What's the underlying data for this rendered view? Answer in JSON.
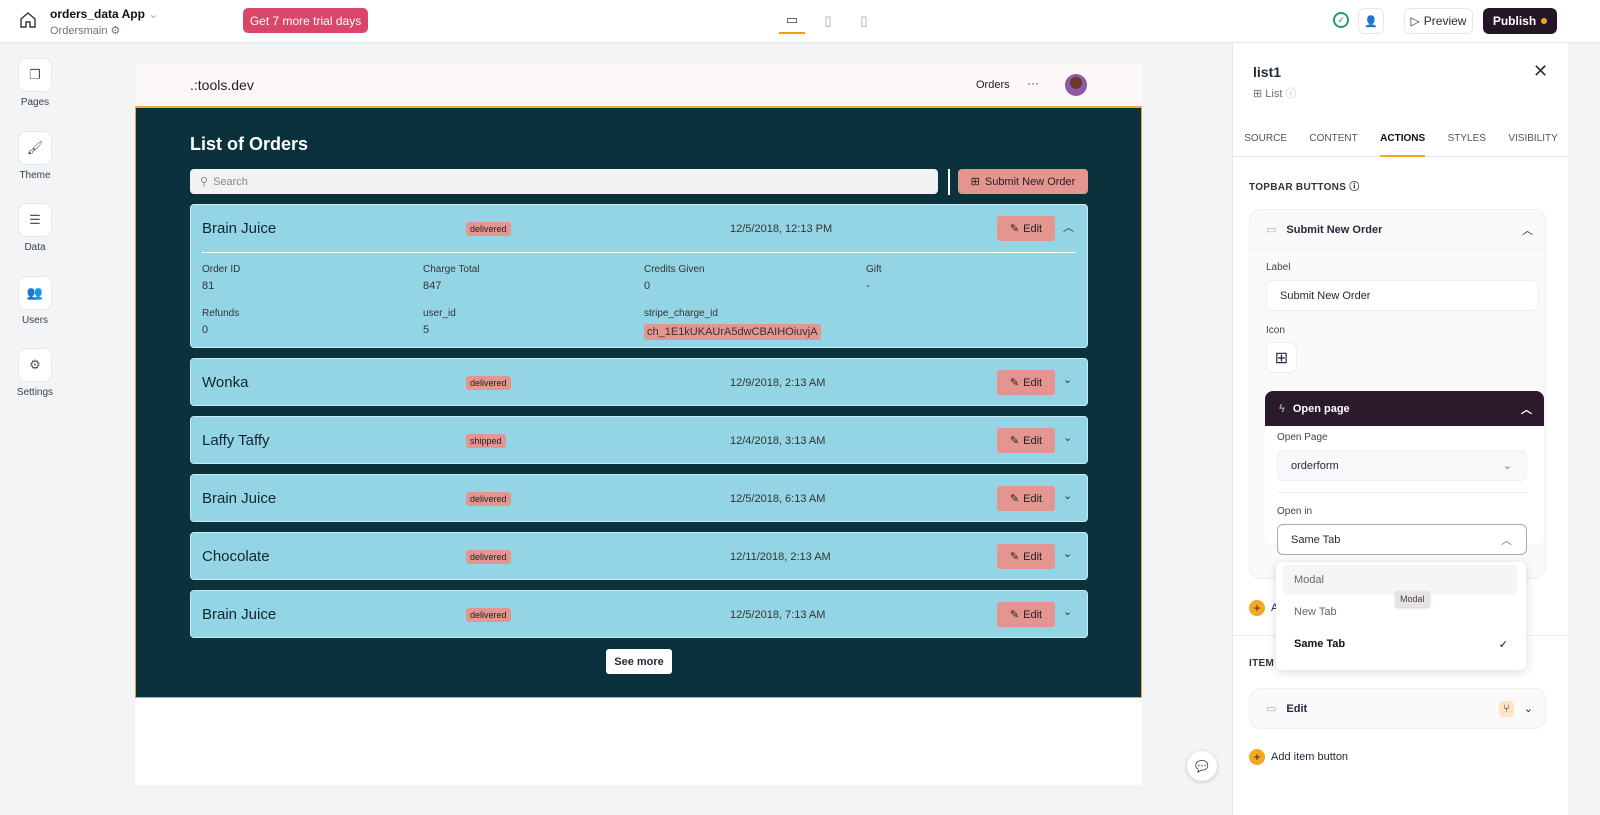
{
  "topbar": {
    "app_name": "orders_data App",
    "page_name": "Ordersmain",
    "trial_label": "Get 7 more trial days",
    "preview_label": "Preview",
    "publish_label": "Publish",
    "status_color": "#22a06b",
    "accent": "#d9466a"
  },
  "sidebar": {
    "items": [
      {
        "label": "Pages",
        "icon": "pages-icon"
      },
      {
        "label": "Theme",
        "icon": "theme-icon"
      },
      {
        "label": "Data",
        "icon": "database-icon"
      },
      {
        "label": "Users",
        "icon": "users-icon"
      },
      {
        "label": "Settings",
        "icon": "gear-icon"
      }
    ]
  },
  "app": {
    "logo": ".:tools.dev",
    "nav_orders": "Orders",
    "nav_more": "···",
    "title": "List of Orders",
    "search_placeholder": "Search",
    "submit_label": "Submit New Order",
    "see_more": "See more",
    "edit_label": "Edit",
    "orders": [
      {
        "name": "Brain Juice",
        "status": "delivered",
        "date": "12/5/2018, 12:13 PM",
        "expanded": true
      },
      {
        "name": "Wonka",
        "status": "delivered",
        "date": "12/9/2018, 2:13 AM"
      },
      {
        "name": "Laffy Taffy",
        "status": "shipped",
        "date": "12/4/2018, 3:13 AM"
      },
      {
        "name": "Brain Juice",
        "status": "delivered",
        "date": "12/5/2018, 6:13 AM"
      },
      {
        "name": "Chocolate",
        "status": "delivered",
        "date": "12/11/2018, 2:13 AM"
      },
      {
        "name": "Brain Juice",
        "status": "delivered",
        "date": "12/5/2018, 7:13 AM"
      }
    ],
    "details": [
      {
        "label": "Order ID",
        "value": "81"
      },
      {
        "label": "Charge Total",
        "value": "847"
      },
      {
        "label": "Credits Given",
        "value": "0"
      },
      {
        "label": "Gift",
        "value": "-"
      },
      {
        "label": "Refunds",
        "value": "0"
      },
      {
        "label": "user_id",
        "value": "5"
      },
      {
        "label": "stripe_charge_id",
        "value": "ch_1E1kUKAUrA5dwCBAIHOiuvjA"
      }
    ]
  },
  "panel": {
    "title": "list1",
    "type": "List",
    "tabs": [
      "SOURCE",
      "CONTENT",
      "ACTIONS",
      "STYLES",
      "VISIBILITY"
    ],
    "active_tab": "ACTIONS",
    "topbar_section": "TOPBAR BUTTONS",
    "button_name": "Submit New Order",
    "label_label": "Label",
    "label_value": "Submit New Order",
    "icon_label": "Icon",
    "action_title": "Open page",
    "open_page_label": "Open Page",
    "open_page_value": "orderform",
    "open_in_label": "Open in",
    "open_in_value": "Same Tab",
    "add_topbar": "A",
    "item_section": "ITEM E",
    "item_button": "Edit",
    "add_item": "Add item button"
  },
  "dropdown": {
    "options": [
      "Modal",
      "New Tab",
      "Same Tab"
    ],
    "selected": "Same Tab",
    "hovered": "Modal",
    "tooltip": "Modal"
  }
}
